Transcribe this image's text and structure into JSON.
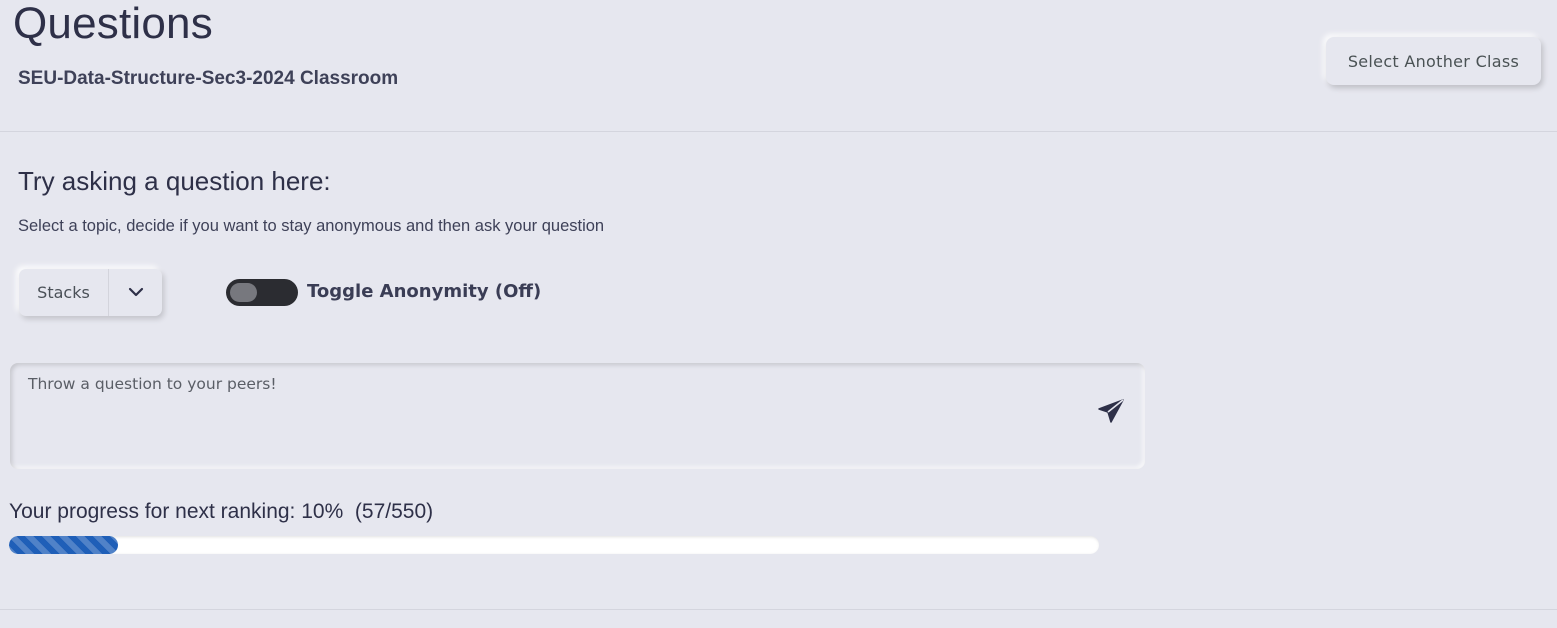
{
  "header": {
    "title": "Questions",
    "class_name": "SEU-Data-Structure-Sec3-2024 Classroom",
    "select_class_label": "Select Another Class"
  },
  "ask": {
    "heading": "Try asking a question here:",
    "subtext": "Select a topic, decide if you want to stay anonymous and then ask your question",
    "topic_selected": "Stacks",
    "anonymity_label": "Toggle Anonymity (Off)",
    "anonymity_on": false,
    "question_placeholder": "Throw a question to your peers!",
    "question_value": ""
  },
  "progress": {
    "text": "Your progress for next ranking: 10%  (57/550)",
    "percent": 10,
    "current": 57,
    "total": 550
  },
  "colors": {
    "background": "#e6e7ef",
    "progress_fill": "#1f5fb8",
    "toggle_off": "#2b2c31",
    "text_dark": "#2e3048"
  },
  "icons": {
    "dropdown": "chevron-down-icon",
    "send": "paper-plane-icon"
  }
}
